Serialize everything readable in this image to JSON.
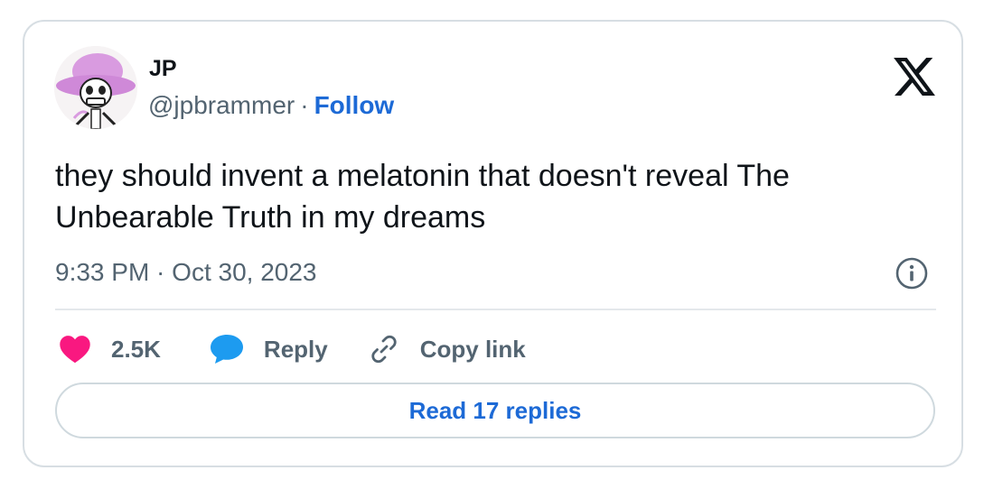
{
  "author": {
    "name": "JP",
    "handle": "@jpbrammer",
    "separator": "·",
    "follow_label": "Follow"
  },
  "tweet": {
    "text": "they should invent a melatonin that doesn't reveal The Unbearable Truth in my dreams",
    "timestamp": "9:33 PM · Oct 30, 2023"
  },
  "actions": {
    "like_count": "2.5K",
    "reply_label": "Reply",
    "copy_link_label": "Copy link"
  },
  "read_replies_label": "Read 17 replies",
  "icons": {
    "logo": "x-logo-icon",
    "info": "info-icon",
    "like": "heart-icon",
    "reply": "speech-bubble-icon",
    "copy": "link-icon"
  },
  "colors": {
    "text_primary": "#0f1419",
    "text_secondary": "#536471",
    "accent_blue": "#1d6ad6",
    "like_pink": "#f91880",
    "reply_blue": "#1d9bf0",
    "border": "#d7dee3"
  }
}
